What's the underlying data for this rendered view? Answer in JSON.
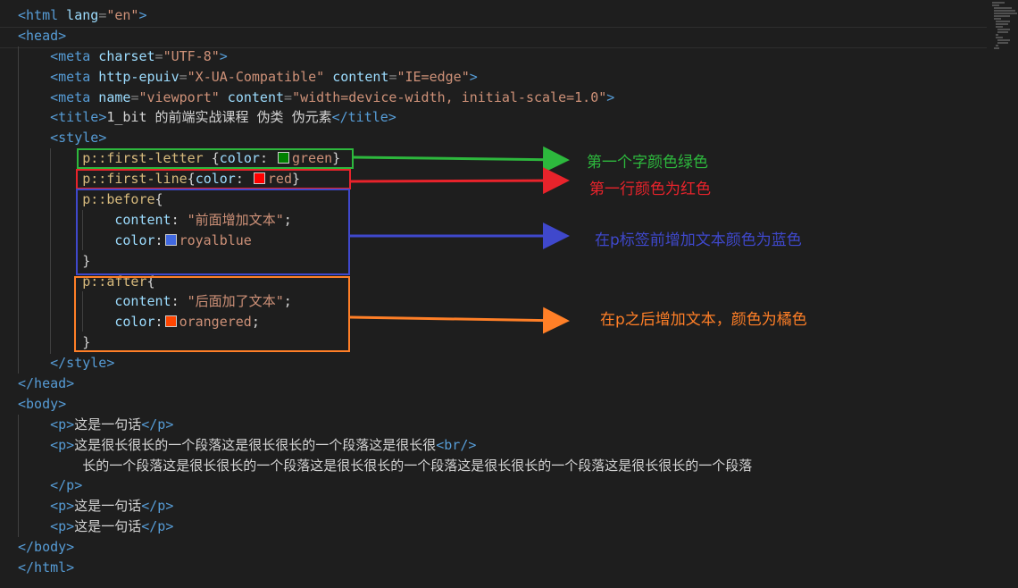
{
  "lines": [
    {
      "indent": "",
      "parts": [
        [
          "t",
          "<html"
        ],
        [
          "a",
          " lang"
        ],
        [
          "p",
          "="
        ],
        [
          "s",
          "\"en\""
        ],
        [
          "t",
          ">"
        ]
      ]
    },
    {
      "indent": "",
      "parts": [
        [
          "t",
          "<head"
        ],
        [
          "t",
          ">"
        ]
      ]
    },
    {
      "indent": "    ",
      "parts": [
        [
          "t",
          "<meta"
        ],
        [
          "a",
          " charset"
        ],
        [
          "p",
          "="
        ],
        [
          "s",
          "\"UTF-8\""
        ],
        [
          "t",
          ">"
        ]
      ]
    },
    {
      "indent": "    ",
      "parts": [
        [
          "t",
          "<meta"
        ],
        [
          "a",
          " http-epuiv"
        ],
        [
          "p",
          "="
        ],
        [
          "s",
          "\"X-UA-Compatible\""
        ],
        [
          "a",
          " content"
        ],
        [
          "p",
          "="
        ],
        [
          "s",
          "\"IE=edge\""
        ],
        [
          "t",
          ">"
        ]
      ]
    },
    {
      "indent": "    ",
      "parts": [
        [
          "t",
          "<meta"
        ],
        [
          "a",
          " name"
        ],
        [
          "p",
          "="
        ],
        [
          "s",
          "\"viewport\""
        ],
        [
          "a",
          " content"
        ],
        [
          "p",
          "="
        ],
        [
          "s",
          "\"width=device-width, initial-scale=1.0\""
        ],
        [
          "t",
          ">"
        ]
      ]
    },
    {
      "indent": "    ",
      "parts": [
        [
          "t",
          "<title"
        ],
        [
          "t",
          ">"
        ],
        [
          "x",
          "1_bit 的前端实战课程 伪类 伪元素"
        ],
        [
          "t",
          "</title>"
        ]
      ]
    },
    {
      "indent": "    ",
      "parts": [
        [
          "t",
          "<style"
        ],
        [
          "t",
          ">"
        ]
      ]
    },
    {
      "indent": "        ",
      "parts": [
        [
          "c",
          "p::first-letter"
        ],
        [
          "x",
          " {"
        ],
        [
          "pr",
          "color"
        ],
        [
          "x",
          ": "
        ],
        [
          "sw",
          "#008000"
        ],
        [
          "v",
          "green"
        ],
        [
          "x",
          "}"
        ]
      ]
    },
    {
      "indent": "        ",
      "parts": [
        [
          "c",
          "p::first-line"
        ],
        [
          "x",
          "{"
        ],
        [
          "pr",
          "color"
        ],
        [
          "x",
          ": "
        ],
        [
          "sw",
          "#ff0000"
        ],
        [
          "v",
          "red"
        ],
        [
          "x",
          "}"
        ]
      ]
    },
    {
      "indent": "        ",
      "parts": [
        [
          "c",
          "p::before"
        ],
        [
          "x",
          "{"
        ]
      ]
    },
    {
      "indent": "            ",
      "parts": [
        [
          "pr",
          "content"
        ],
        [
          "x",
          ": "
        ],
        [
          "s",
          "\"前面增加文本\""
        ],
        [
          "x",
          ";"
        ]
      ]
    },
    {
      "indent": "            ",
      "parts": [
        [
          "pr",
          "color"
        ],
        [
          "x",
          ":"
        ],
        [
          "sw",
          "#4169e1"
        ],
        [
          "v",
          "royalblue"
        ]
      ]
    },
    {
      "indent": "        ",
      "parts": [
        [
          "x",
          "}"
        ]
      ]
    },
    {
      "indent": "        ",
      "parts": [
        [
          "c",
          "p::after"
        ],
        [
          "x",
          "{"
        ]
      ]
    },
    {
      "indent": "            ",
      "parts": [
        [
          "pr",
          "content"
        ],
        [
          "x",
          ": "
        ],
        [
          "s",
          "\"后面加了文本\""
        ],
        [
          "x",
          ";"
        ]
      ]
    },
    {
      "indent": "            ",
      "parts": [
        [
          "pr",
          "color"
        ],
        [
          "x",
          ":"
        ],
        [
          "sw",
          "#ff4500"
        ],
        [
          "v",
          "orangered"
        ],
        [
          "x",
          ";"
        ]
      ]
    },
    {
      "indent": "        ",
      "parts": [
        [
          "x",
          "}"
        ]
      ]
    },
    {
      "indent": "    ",
      "parts": [
        [
          "t",
          "</style>"
        ]
      ]
    },
    {
      "indent": "",
      "parts": [
        [
          "t",
          "</head>"
        ]
      ]
    },
    {
      "indent": "",
      "parts": [
        [
          "t",
          "<body>"
        ]
      ]
    },
    {
      "indent": "    ",
      "parts": [
        [
          "t",
          "<p>"
        ],
        [
          "x",
          "这是一句话"
        ],
        [
          "t",
          "</p>"
        ]
      ]
    },
    {
      "indent": "    ",
      "parts": [
        [
          "t",
          "<p>"
        ],
        [
          "x",
          "这是很长很长的一个段落这是很长很长的一个段落这是很长很"
        ],
        [
          "t",
          "<br/>"
        ]
      ]
    },
    {
      "indent": "        ",
      "parts": [
        [
          "x",
          "长的一个段落这是很长很长的一个段落这是很长很长的一个段落这是很长很长的一个段落这是很长很长的一个段落"
        ]
      ]
    },
    {
      "indent": "    ",
      "parts": [
        [
          "t",
          "</p>"
        ]
      ]
    },
    {
      "indent": "    ",
      "parts": [
        [
          "t",
          "<p>"
        ],
        [
          "x",
          "这是一句话"
        ],
        [
          "t",
          "</p>"
        ]
      ]
    },
    {
      "indent": "    ",
      "parts": [
        [
          "t",
          "<p>"
        ],
        [
          "x",
          "这是一句话"
        ],
        [
          "t",
          "</p>"
        ]
      ]
    },
    {
      "indent": "",
      "parts": [
        [
          "t",
          "</body>"
        ]
      ]
    },
    {
      "indent": "",
      "parts": [
        [
          "t",
          "</html>"
        ]
      ]
    }
  ],
  "annotations": [
    {
      "name": "first-letter",
      "text": "第一个字颜色绿色",
      "color": "#2db83d"
    },
    {
      "name": "first-line",
      "text": "第一行颜色为红色",
      "color": "#e8232b"
    },
    {
      "name": "before",
      "text": "在p标签前增加文本颜色为蓝色",
      "color": "#3f48cc"
    },
    {
      "name": "after",
      "text": "在p之后增加文本，颜色为橘色",
      "color": "#ff7f27"
    }
  ]
}
